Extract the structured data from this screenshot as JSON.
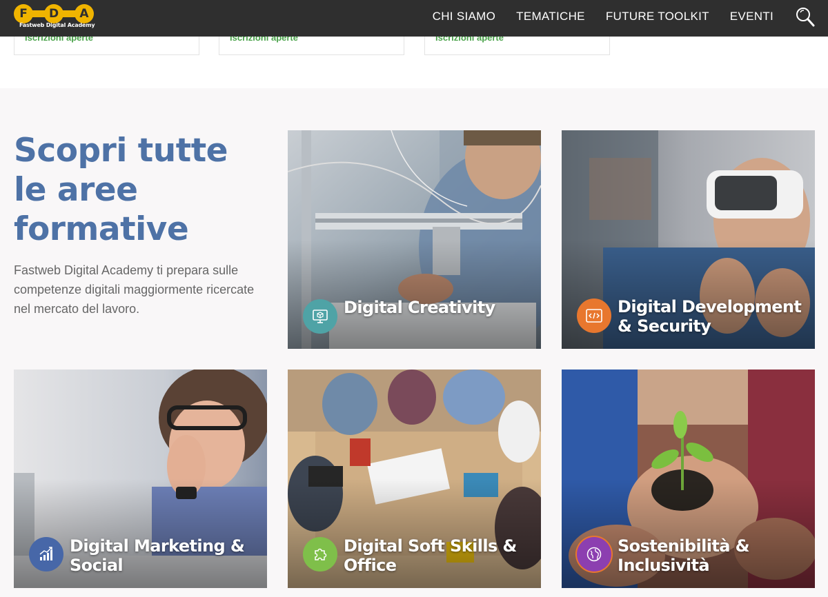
{
  "header": {
    "logo_letters": [
      "F",
      "D",
      "A"
    ],
    "logo_subtitle": "Fastweb Digital Academy",
    "nav": [
      "CHI SIAMO",
      "TEMATICHE",
      "FUTURE TOOLKIT",
      "EVENTI"
    ],
    "search_icon": "search-icon"
  },
  "top_cards": [
    {
      "status": "Iscrizioni aperte"
    },
    {
      "status": "Iscrizioni aperte"
    },
    {
      "status": "Iscrizioni aperte"
    }
  ],
  "intro": {
    "title": "Scopri tutte le aree formative",
    "text": "Fastweb Digital Academy ti prepara sulle competenze digitali maggiormente ricercate nel mercato del lavoro."
  },
  "areas": [
    {
      "line1": "Digital Creativity",
      "line2": "",
      "icon": "monitor-cube-icon",
      "badge_color": "#4fa3a6"
    },
    {
      "line1": "Digital Development",
      "line2": "& Security",
      "icon": "code-icon",
      "badge_color": "#e8772e"
    },
    {
      "line1": "Digital Marketing &",
      "line2": "Social",
      "icon": "growth-chart-icon",
      "badge_color": "#4767a8"
    },
    {
      "line1": "Digital Soft Skills &",
      "line2": "Office",
      "icon": "puzzle-icon",
      "badge_color": "#7fbf4a"
    },
    {
      "line1": "Sostenibilità &",
      "line2": "Inclusività",
      "icon": "globe-icon",
      "badge_color": "#8c3fb0"
    }
  ],
  "colors": {
    "header_bg": "#2f2f2f",
    "logo_yellow": "#f0b400",
    "title_blue": "#4e72a6",
    "status_green": "#4aa24a",
    "page_bg": "#f9f7f8"
  }
}
